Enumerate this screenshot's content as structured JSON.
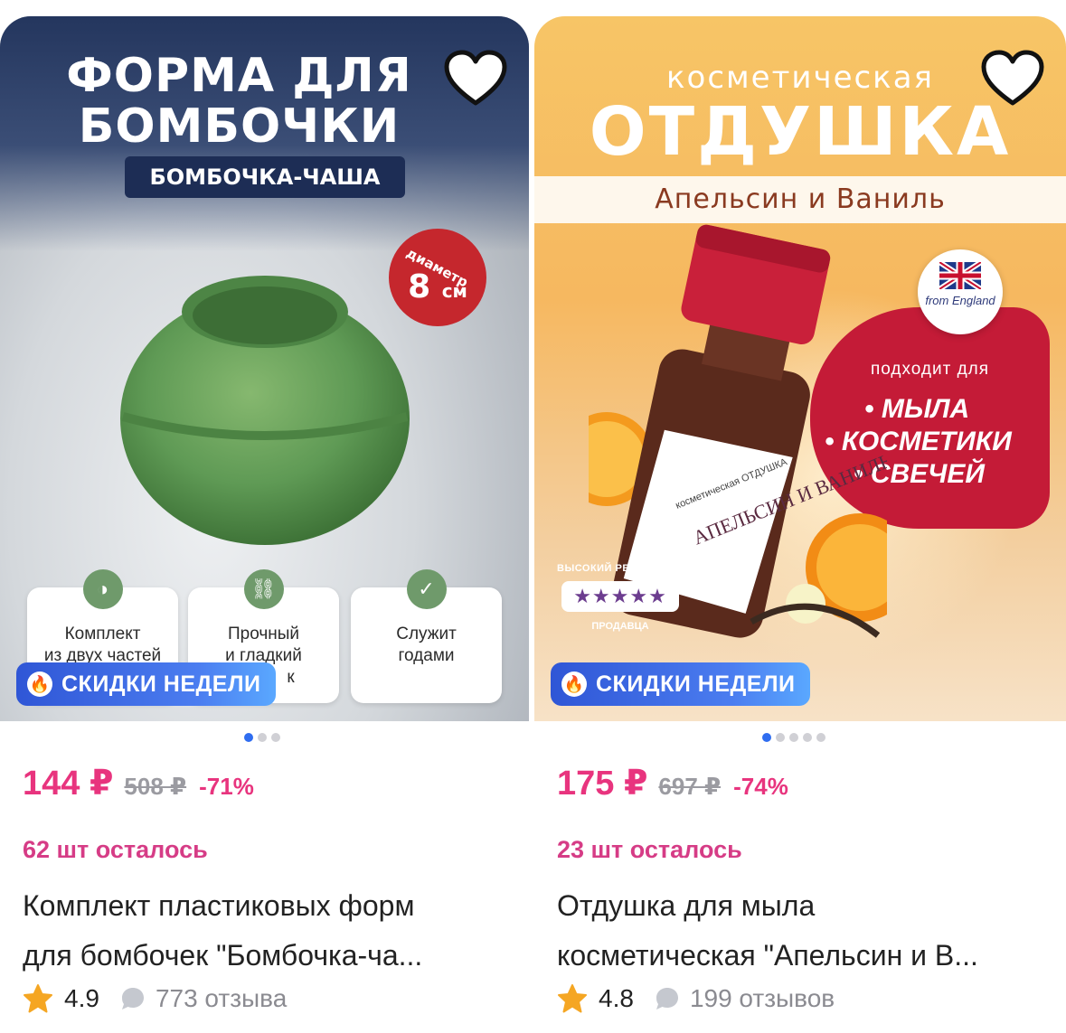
{
  "products": [
    {
      "image_text": {
        "headline_1": "ФОРМА ДЛЯ",
        "headline_2": "БОМБОЧКИ",
        "subtitle": "БОМБОЧКА-ЧАША",
        "diameter_label": "диаметр",
        "diameter_value": "8",
        "diameter_unit": "см",
        "features": [
          {
            "icon": "split-parts-icon",
            "line1": "Комплект",
            "line2": "из двух частей"
          },
          {
            "icon": "link-icon",
            "line1": "Прочный",
            "line2": "и гладкий",
            "line3": "к"
          },
          {
            "icon": "check-badge-icon",
            "line1": "Служит",
            "line2": "годами"
          }
        ]
      },
      "promo_badge": "СКИДКИ НЕДЕЛИ",
      "image_dots": 3,
      "active_dot": 0,
      "price": "144 ₽",
      "old_price": "508 ₽",
      "discount": "-71%",
      "stock": "62 шт осталось",
      "title_line1": "Комплект пластиковых форм",
      "title_line2": "для бомбочек \"Бомбочка-ча...",
      "rating": "4.9",
      "reviews": "773 отзыва"
    },
    {
      "image_text": {
        "small_title": "косметическая",
        "big_title": "ОТДУШКА",
        "band": "Апельсин и Ваниль",
        "england": "from England",
        "suits_for": "подходит для",
        "uses": [
          "• МЫЛА",
          "• КОСМЕТИКИ",
          "• СВЕЧЕЙ"
        ],
        "label_brand": "косметическая ОТДУШКА",
        "label_name": "АПЕЛЬСИН И ВАНИЛЬ",
        "rating_top": "ВЫСОКИЙ РЕЙТИНГ",
        "rating_stars": "★★★★★",
        "rating_bottom": "ПРОДАВЦА"
      },
      "promo_badge": "СКИДКИ НЕДЕЛИ",
      "image_dots": 5,
      "active_dot": 0,
      "price": "175 ₽",
      "old_price": "697 ₽",
      "discount": "-74%",
      "stock": "23 шт осталось",
      "title_line1": "Отдушка для мыла",
      "title_line2": "косметическая \"Апельсин и В...",
      "rating": "4.8",
      "reviews": "199 отзывов"
    }
  ],
  "colors": {
    "price": "#e8347e",
    "stock": "#d63c86",
    "promo": "#2f56d6",
    "active_dot": "#2f6df0",
    "star": "#f5a623"
  }
}
